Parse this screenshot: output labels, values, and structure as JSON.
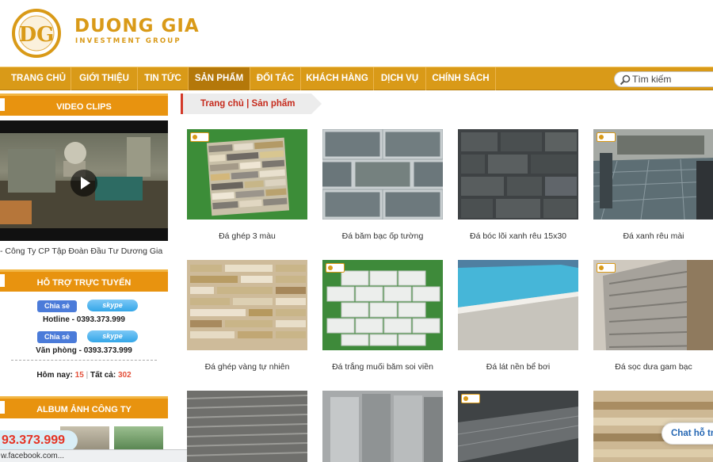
{
  "brand": {
    "name": "DUONG GIA",
    "subtitle": "INVESTMENT GROUP",
    "logo_text": "DG"
  },
  "nav": {
    "items": [
      {
        "label": "TRANG CHỦ",
        "active": false
      },
      {
        "label": "GIỚI THIỆU",
        "active": false
      },
      {
        "label": "TIN TỨC",
        "active": false
      },
      {
        "label": "SẢN PHẨM",
        "active": true
      },
      {
        "label": "ĐỐI TÁC",
        "active": false
      },
      {
        "label": "KHÁCH HÀNG",
        "active": false
      },
      {
        "label": "DỊCH VỤ",
        "active": false
      },
      {
        "label": "CHÍNH SÁCH",
        "active": false
      }
    ],
    "search_placeholder": "Tìm kiếm"
  },
  "sidebar": {
    "video_title": "VIDEO CLIPS",
    "video_caption": "- Công Ty CP Tập Đoàn Đầu Tư Dương Gia",
    "support_title": "HỖ TRỢ TRỰC TUYẾN",
    "share_label": "Chia sẻ",
    "skype_label": "skype",
    "hotline": "Hotline - 0393.373.999",
    "office": "Văn phòng - 0393.373.999",
    "today_label": "Hôm nay:",
    "today_value": "15",
    "total_label": "Tất cả:",
    "total_value": "302",
    "album_title": "ALBUM ẢNH CÔNG TY",
    "hotline_float": "93.373.999"
  },
  "breadcrumb": "Trang chủ | Sản phẩm",
  "products": [
    {
      "name": "Đá ghép 3 màu"
    },
    {
      "name": "Đá băm bạc ốp tường"
    },
    {
      "name": "Đá bóc lõi xanh rêu 15x30"
    },
    {
      "name": "Đá xanh rêu mài"
    },
    {
      "name": "Đá ghép vàng tự nhiên"
    },
    {
      "name": "Đá trắng muối băm soi viền"
    },
    {
      "name": "Đá lát nền bể bơi"
    },
    {
      "name": "Đá sọc dưa gam bạc"
    }
  ],
  "chat_label": "Chat hỗ trợ",
  "status_url": "w.facebook.com...",
  "colors": {
    "accent": "#d99a18",
    "nav_active": "#b4780a",
    "sidebar_head": "#e8930f",
    "crumb": "#c62b1d"
  }
}
